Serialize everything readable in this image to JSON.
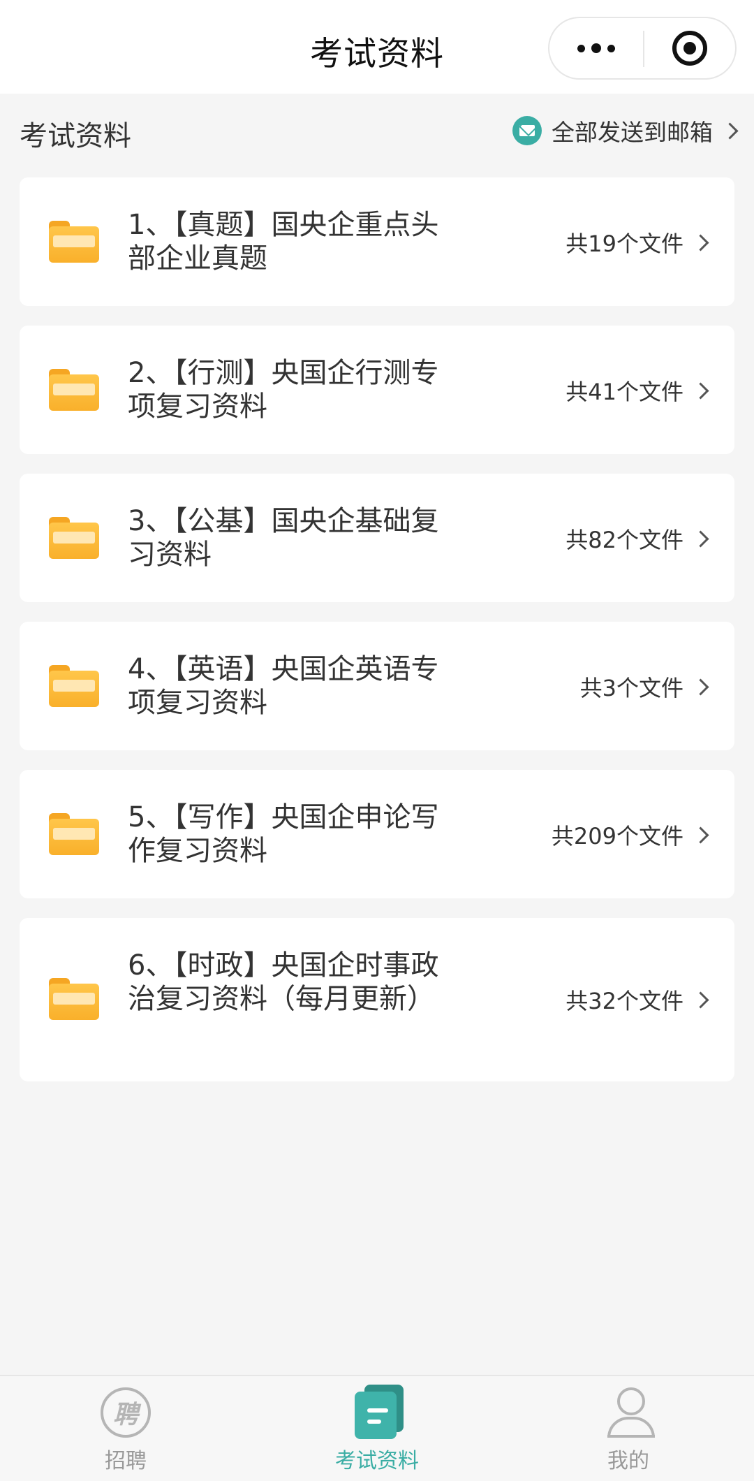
{
  "navbar": {
    "title": "考试资料"
  },
  "section": {
    "title": "考试资料",
    "send_all_label": "全部发送到邮箱"
  },
  "folders": [
    {
      "title": "1、【真题】国央企重点头部企业真题",
      "count": "共19个文件"
    },
    {
      "title": "2、【行测】央国企行测专项复习资料",
      "count": "共41个文件"
    },
    {
      "title": "3、【公基】国央企基础复习资料",
      "count": "共82个文件"
    },
    {
      "title": "4、【英语】央国企英语专项复习资料",
      "count": "共3个文件"
    },
    {
      "title": "5、【写作】央国企申论写作复习资料",
      "count": "共209个文件"
    },
    {
      "title": "6、【时政】央国企时事政治复习资料（每月更新）",
      "count": "共32个文件"
    }
  ],
  "tabbar": {
    "items": [
      {
        "label": "招聘",
        "icon": "recruit-icon",
        "active": false,
        "glyph": "聘"
      },
      {
        "label": "考试资料",
        "icon": "exam-materials-icon",
        "active": true
      },
      {
        "label": "我的",
        "icon": "user-icon",
        "active": false
      }
    ]
  },
  "colors": {
    "accent": "#3aada4",
    "folder": "#f9b02b"
  }
}
